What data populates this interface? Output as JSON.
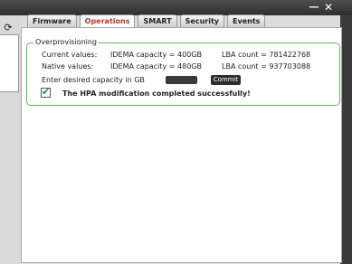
{
  "window": {
    "minimize_label": "—",
    "close_label": "✕"
  },
  "tabs": [
    {
      "label": "Firmware"
    },
    {
      "label": "Operations"
    },
    {
      "label": "SMART"
    },
    {
      "label": "Security"
    },
    {
      "label": "Events"
    }
  ],
  "active_tab": "Operations",
  "overprovisioning": {
    "title": "Overprovisioning",
    "current_label": "Current values:",
    "current_idema": "IDEMA capacity = 400GB",
    "current_lba": "LBA count = 781422768",
    "native_label": "Native values:",
    "native_idema": "IDEMA capacity = 480GB",
    "native_lba": "LBA count = 937703088",
    "enter_label": "Enter desired capacity in GB",
    "input_value": "",
    "commit_label": "Commit",
    "success_message": "The HPA modification completed successfully!",
    "checked": true
  },
  "colors": {
    "active_tab_text": "#c0322f",
    "section_border": "#5cb85c",
    "checkmark": "#2a8a2a"
  }
}
